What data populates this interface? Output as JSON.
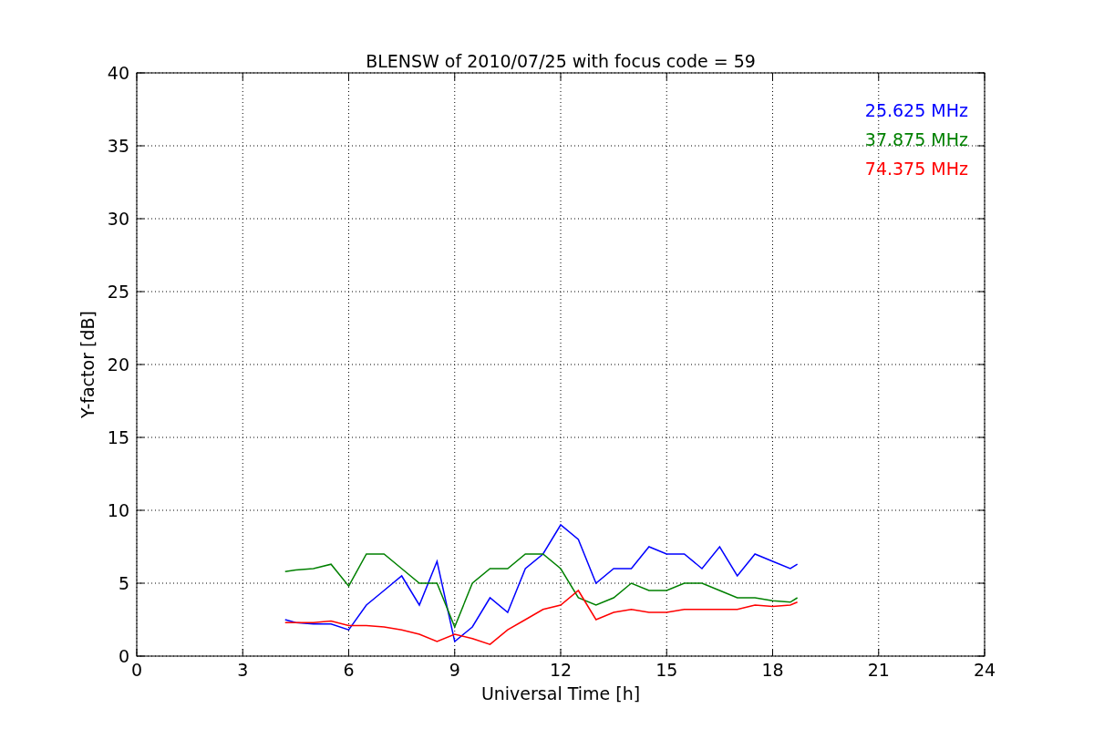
{
  "figure": {
    "chart_data": {
      "type": "line",
      "title": "BLENSW of 2010/07/25 with focus code = 59",
      "xlabel": "Universal Time [h]",
      "ylabel": "Y-factor [dB]",
      "x": [
        4.2,
        4.5,
        5,
        5.5,
        6,
        6.5,
        7,
        7.5,
        8,
        8.5,
        9,
        9.5,
        10,
        10.5,
        11,
        11.5,
        12,
        12.5,
        13,
        13.5,
        14,
        14.5,
        15,
        15.5,
        16,
        16.5,
        17,
        17.5,
        18,
        18.5,
        18.7
      ],
      "series": [
        {
          "name": "25.625 MHz",
          "color": "#0000ff",
          "values": [
            2.5,
            2.3,
            2.2,
            2.2,
            1.8,
            3.5,
            4.5,
            5.5,
            3.5,
            6.5,
            1.0,
            2,
            4,
            3,
            6,
            7,
            9,
            8,
            5,
            6,
            6,
            7.5,
            7,
            7,
            6,
            7.5,
            5.5,
            7,
            6.5,
            6,
            6.3
          ]
        },
        {
          "name": "37.875 MHz",
          "color": "#008000",
          "values": [
            5.8,
            5.9,
            6.0,
            6.3,
            4.8,
            7,
            7,
            6,
            5,
            5,
            2,
            5,
            6,
            6,
            7,
            7,
            6,
            4,
            3.5,
            4,
            5,
            4.5,
            4.5,
            5,
            5,
            4.5,
            4,
            4,
            3.8,
            3.7,
            4
          ]
        },
        {
          "name": "74.375 MHz",
          "color": "#ff0000",
          "values": [
            2.3,
            2.3,
            2.3,
            2.4,
            2.1,
            2.1,
            2,
            1.8,
            1.5,
            1,
            1.5,
            1.2,
            0.8,
            1.8,
            2.5,
            3.2,
            3.5,
            4.5,
            2.5,
            3,
            3.2,
            3,
            3,
            3.2,
            3.2,
            3.2,
            3.2,
            3.5,
            3.4,
            3.5,
            3.7
          ]
        }
      ],
      "grid": true,
      "xlim": [
        0,
        24
      ],
      "ylim": [
        0,
        40
      ],
      "xticks": [
        0,
        3,
        6,
        9,
        12,
        15,
        18,
        21,
        24
      ],
      "yticks": [
        0,
        5,
        10,
        15,
        20,
        25,
        30,
        35,
        40
      ]
    }
  }
}
